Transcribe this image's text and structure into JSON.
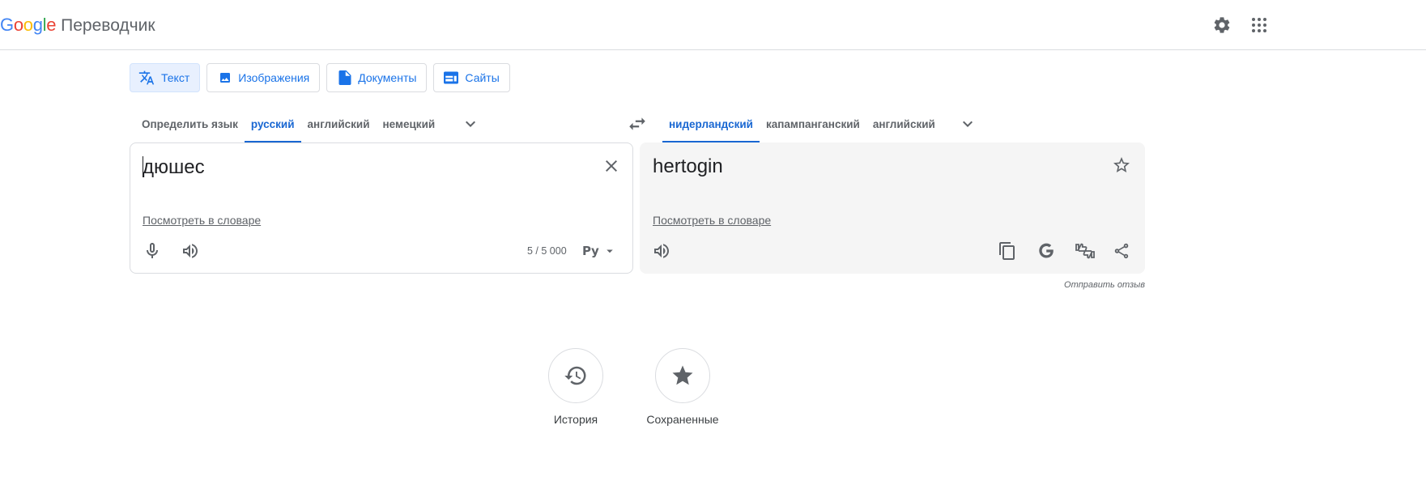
{
  "header": {
    "logo_letters": [
      "G",
      "o",
      "o",
      "g",
      "l",
      "e"
    ],
    "product_name": "Переводчик",
    "settings_icon": "gear-icon",
    "apps_icon": "apps-grid-icon"
  },
  "colors": {
    "blue": "#4285F4",
    "red": "#EA4335",
    "yellow": "#FBBC05",
    "green": "#34A853",
    "accent": "#1a73e8"
  },
  "modes": [
    {
      "label": "Текст",
      "icon": "translate-icon",
      "active": true
    },
    {
      "label": "Изображения",
      "icon": "image-icon",
      "active": false
    },
    {
      "label": "Документы",
      "icon": "document-icon",
      "active": false
    },
    {
      "label": "Сайты",
      "icon": "website-icon",
      "active": false
    }
  ],
  "source_langs": [
    "Определить язык",
    "русский",
    "английский",
    "немецкий"
  ],
  "source_selected": "русский",
  "target_langs": [
    "нидерландский",
    "капампанганский",
    "английский"
  ],
  "target_selected": "нидерландский",
  "source": {
    "text": "дюшес",
    "dictionary_link": "Посмотреть в словаре",
    "counter": "5 / 5 000",
    "translit": "Ру"
  },
  "target": {
    "text": "hertogin",
    "dictionary_link": "Посмотреть в словаре"
  },
  "feedback": "Отправить отзыв",
  "bottom": {
    "history": "История",
    "saved": "Сохраненные"
  }
}
